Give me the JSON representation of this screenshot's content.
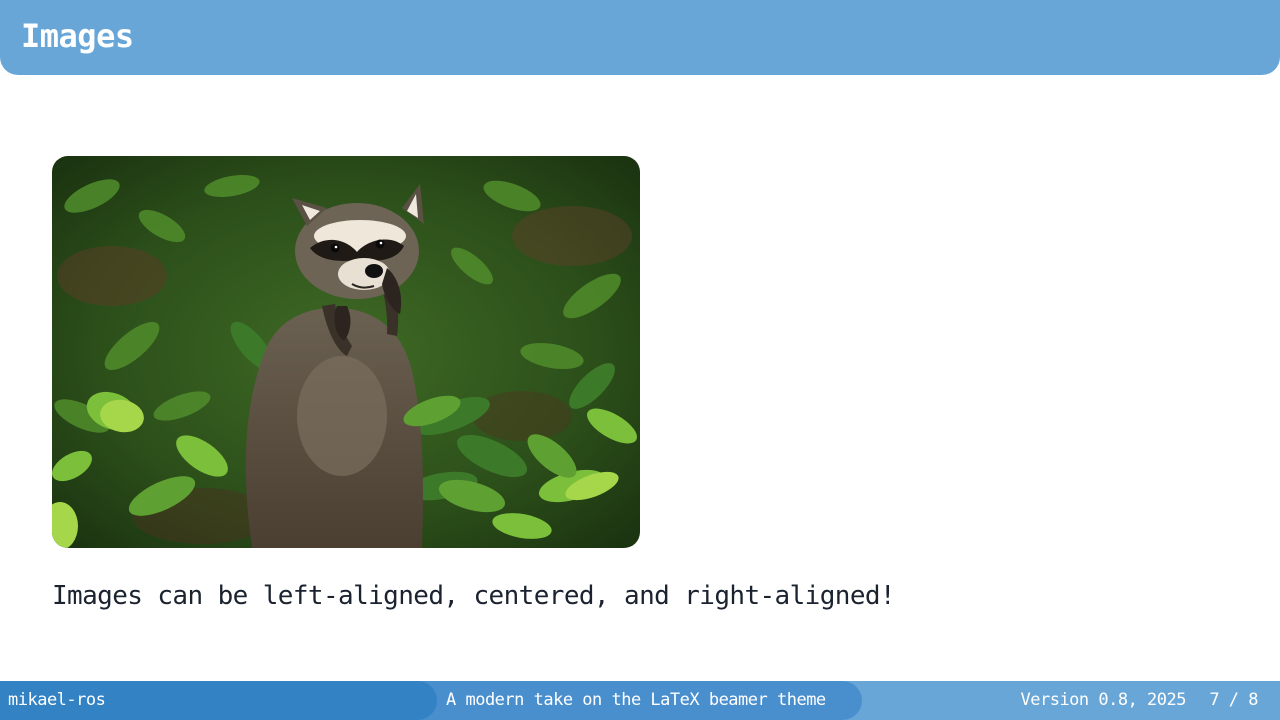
{
  "slide": {
    "title": "Images",
    "image_alt": "raccoon-standing-in-green-foliage-photo",
    "caption": "Images can be left-aligned, centered, and right-aligned!"
  },
  "footer": {
    "author": "mikael-ros",
    "subtitle": "A modern take on the LaTeX beamer theme",
    "version": "Version 0.8, 2025",
    "page": "7 / 8"
  },
  "colors": {
    "header": "#69a6d8",
    "footer_left": "#3282c4",
    "footer_mid": "#4a8fcd",
    "footer_right": "#69a6d8",
    "text": "#1b2330"
  }
}
